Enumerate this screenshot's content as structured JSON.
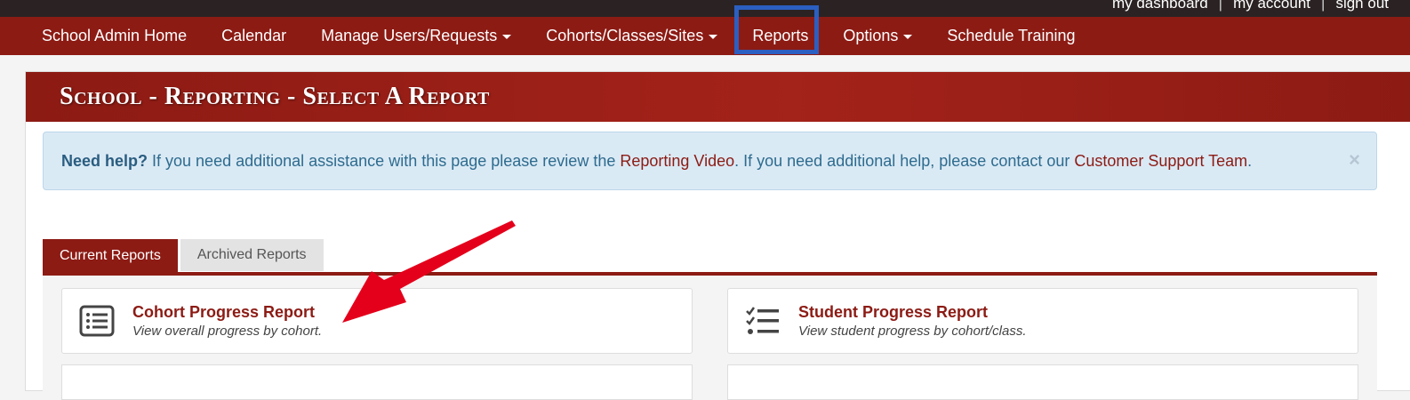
{
  "topbar": {
    "links": [
      "my dashboard",
      "my account",
      "sign out"
    ]
  },
  "nav": {
    "items": [
      {
        "label": "School Admin Home",
        "dropdown": false
      },
      {
        "label": "Calendar",
        "dropdown": false
      },
      {
        "label": "Manage Users/Requests",
        "dropdown": true
      },
      {
        "label": "Cohorts/Classes/Sites",
        "dropdown": true
      },
      {
        "label": "Reports",
        "dropdown": false
      },
      {
        "label": "Options",
        "dropdown": true
      },
      {
        "label": "Schedule Training",
        "dropdown": false
      }
    ]
  },
  "page": {
    "title": "School - Reporting - Select A Report"
  },
  "help": {
    "lead": "Need help?",
    "text1": " If you need additional assistance with this page please review the ",
    "link1": "Reporting Video",
    "text2": ". If you need additional help, please contact our ",
    "link2": "Customer Support Team",
    "text3": ".",
    "close": "×"
  },
  "tabs": {
    "current": "Current Reports",
    "archived": "Archived Reports"
  },
  "reports": [
    {
      "title": "Cohort Progress Report",
      "subtitle": "View overall progress by cohort.",
      "icon": "list-icon"
    },
    {
      "title": "Student Progress Report",
      "subtitle": "View student progress by cohort/class.",
      "icon": "checklist-icon"
    }
  ],
  "colors": {
    "brand": "#8c1b14",
    "highlight": "#2b5fc1",
    "arrow": "#e4001b"
  }
}
